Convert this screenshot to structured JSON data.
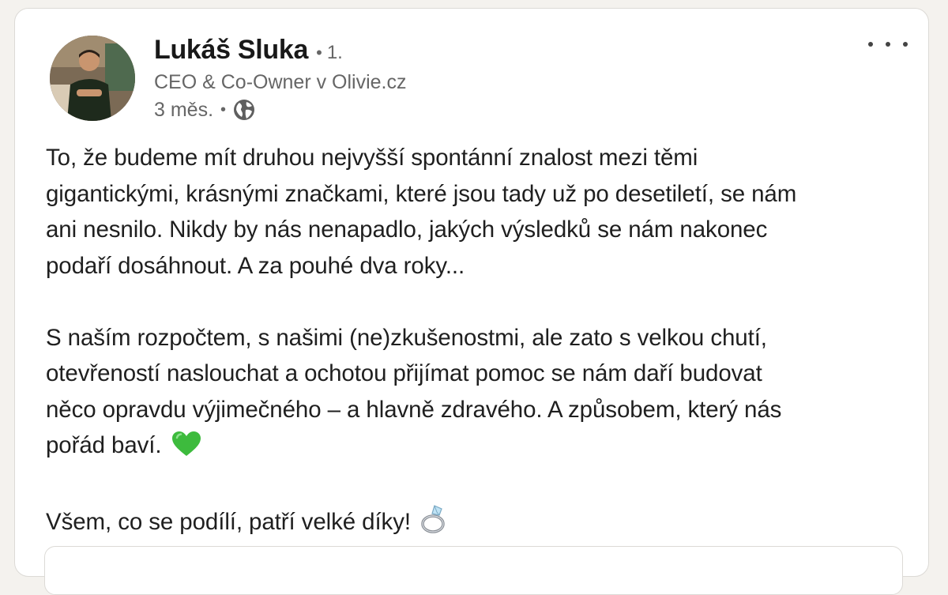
{
  "post": {
    "author": {
      "name": "Lukáš Sluka",
      "degree": "1.",
      "headline": "CEO & Co-Owner v Olivie.cz",
      "timestamp": "3 měs."
    },
    "visibility_icon": "globe-icon",
    "more_icon": "ellipsis-icon",
    "paragraphs": [
      [
        "To, že budeme mít druhou nejvyšší spontánní znalost mezi těmi",
        "gigantickými, krásnými značkami, které jsou tady už po desetiletí, se nám",
        "ani nesnilo. Nikdy by nás nenapadlo, jakých výsledků se nám nakonec",
        "podaří dosáhnout. A za pouhé dva roky..."
      ],
      [
        "S naším rozpočtem, s našimi (ne)zkušenostmi, ale zato s velkou chutí,",
        "otevřeností naslouchat a ochotou přijímat pomoc se nám daří budovat",
        "něco opravdu výjimečného – a hlavně zdravého. A způsobem, který nás",
        "pořád baví."
      ],
      [
        "Všem, co se podílí, patří velké díky!"
      ]
    ],
    "emojis": {
      "heart": "green-heart-emoji",
      "ring": "ring-emoji"
    }
  },
  "colors": {
    "card_bg": "#ffffff",
    "page_bg": "#f4f2ee",
    "muted_text": "#666666",
    "text": "#1f1f1f",
    "heart": "#3dbb3d"
  }
}
